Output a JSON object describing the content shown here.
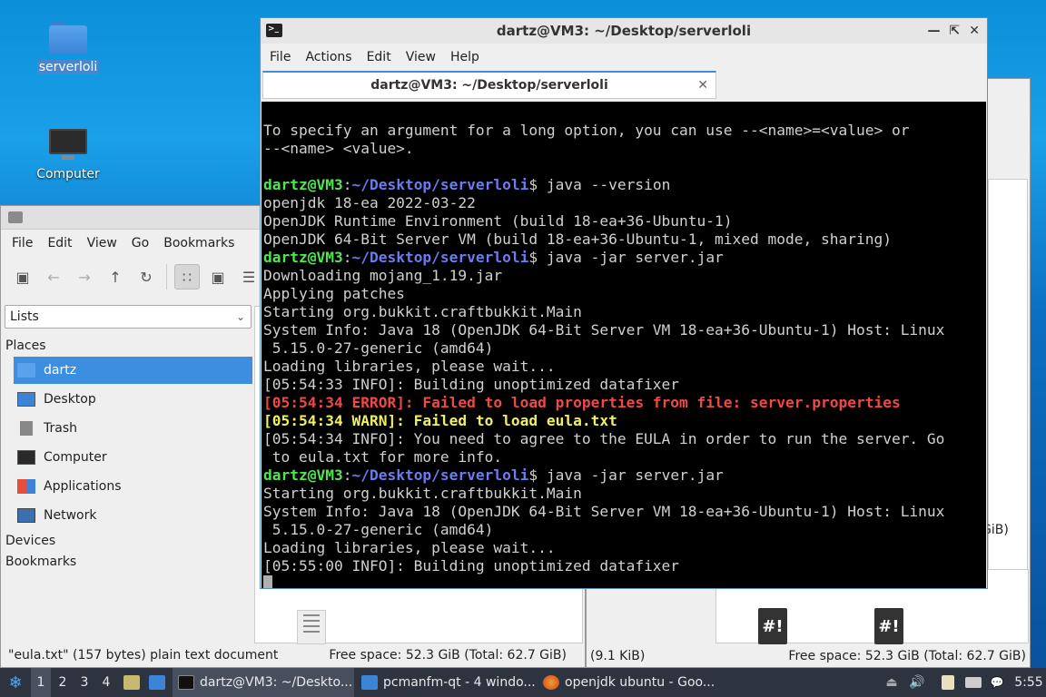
{
  "desktop": {
    "icons": [
      {
        "label": "serverloli",
        "icon": "folder-icon"
      },
      {
        "label": "Computer",
        "icon": "monitor-icon"
      }
    ]
  },
  "file_manager": {
    "menu": [
      "File",
      "Edit",
      "View",
      "Go",
      "Bookmarks"
    ],
    "view_select": "Lists",
    "places_header": "Places",
    "places": [
      "dartz",
      "Desktop",
      "Trash",
      "Computer",
      "Applications",
      "Network"
    ],
    "devices_header": "Devices",
    "bookmarks_header": "Bookmarks",
    "status_left": "\"eula.txt\" (157 bytes) plain text document",
    "status_right": "Free space: 52.3 GiB (Total: 62.7 GiB)"
  },
  "file_manager_2": {
    "status_left": "(9.1 KiB)",
    "status_right": "Free space: 52.3 GiB (Total: 62.7 GiB)",
    "partial_text": "GiB)"
  },
  "terminal": {
    "title": "dartz@VM3: ~/Desktop/serverloli",
    "menu": [
      "File",
      "Actions",
      "Edit",
      "View",
      "Help"
    ],
    "tab_title": "dartz@VM3: ~/Desktop/serverloli",
    "prompt_user": "dartz@VM3",
    "prompt_path": "~/Desktop/serverloli",
    "lines": [
      "To specify an argument for a long option, you can use --<name>=<value> or",
      "--<name> <value>.",
      "",
      "java --version",
      "openjdk 18-ea 2022-03-22",
      "OpenJDK Runtime Environment (build 18-ea+36-Ubuntu-1)",
      "OpenJDK 64-Bit Server VM (build 18-ea+36-Ubuntu-1, mixed mode, sharing)",
      "java -jar server.jar",
      "Downloading mojang_1.19.jar",
      "Applying patches",
      "Starting org.bukkit.craftbukkit.Main",
      "System Info: Java 18 (OpenJDK 64-Bit Server VM 18-ea+36-Ubuntu-1) Host: Linux",
      " 5.15.0-27-generic (amd64)",
      "Loading libraries, please wait...",
      "[05:54:33 INFO]: Building unoptimized datafixer",
      "[05:54:34 ERROR]: Failed to load properties from file: server.properties",
      "[05:54:34 WARN]: Failed to load eula.txt",
      "[05:54:34 INFO]: You need to agree to the EULA in order to run the server. Go",
      " to eula.txt for more info.",
      "java -jar server.jar",
      "Starting org.bukkit.craftbukkit.Main",
      "System Info: Java 18 (OpenJDK 64-Bit Server VM 18-ea+36-Ubuntu-1) Host: Linux",
      " 5.15.0-27-generic (amd64)",
      "Loading libraries, please wait...",
      "[05:55:00 INFO]: Building unoptimized datafixer"
    ],
    "prompt_suffix": "$ "
  },
  "taskbar": {
    "workspaces": [
      "1",
      "2",
      "3",
      "4"
    ],
    "tasks": [
      {
        "label": "dartz@VM3: ~/Deskto...",
        "icon": "terminal-icon"
      },
      {
        "label": "pcmanfm-qt - 4 windo...",
        "icon": "folder-icon"
      },
      {
        "label": "openjdk ubuntu - Goo...",
        "icon": "firefox-icon"
      }
    ],
    "clock": "5:55"
  },
  "colors": {
    "prompt_user": "#4ee84e",
    "prompt_path": "#6a7cf0",
    "error": "#f04848",
    "warn": "#f0f060",
    "selection": "#3d8ee0"
  }
}
